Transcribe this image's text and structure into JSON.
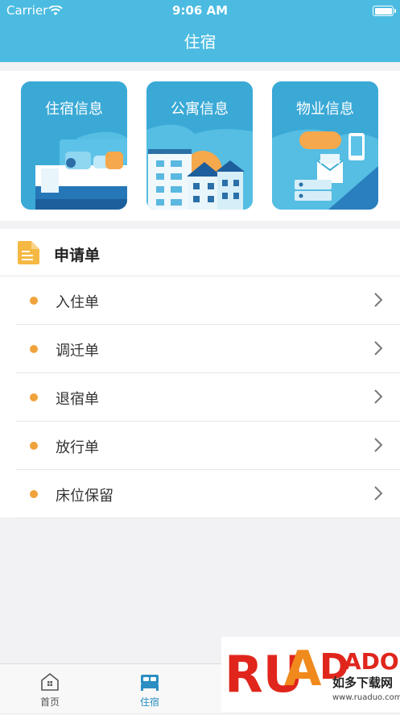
{
  "status_bar": {
    "carrier": "Carrier",
    "time": "9:06 AM"
  },
  "nav": {
    "title": "住宿"
  },
  "cards": [
    {
      "label": "住宿信息",
      "icon": "bed-illustration"
    },
    {
      "label": "公寓信息",
      "icon": "apartment-illustration"
    },
    {
      "label": "物业信息",
      "icon": "property-illustration"
    }
  ],
  "applications": {
    "title": "申请单",
    "items": [
      {
        "label": "入住单"
      },
      {
        "label": "调迁单"
      },
      {
        "label": "退宿单"
      },
      {
        "label": "放行单"
      },
      {
        "label": "床位保留"
      }
    ]
  },
  "tabbar": {
    "items": [
      {
        "label": "首页",
        "icon": "home-icon",
        "active": false
      },
      {
        "label": "住宿",
        "icon": "bed-icon",
        "active": true
      }
    ]
  },
  "watermark": {
    "brand": "RUANDADO",
    "tagline": "如多下载网",
    "url": "www.ruaduo.com"
  },
  "colors": {
    "primary": "#4bbbe1",
    "card": "#3aa9d6",
    "accent": "#f0a23c",
    "active_tab": "#2a8ec2"
  }
}
